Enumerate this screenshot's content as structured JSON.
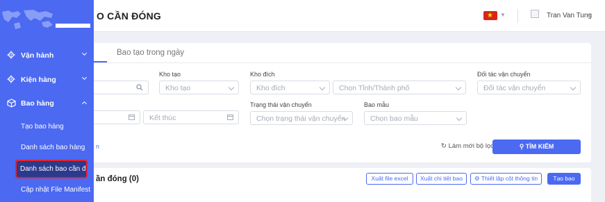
{
  "header": {
    "page_title": "O CẦN ĐÓNG",
    "user_name": "Tran Van Tung"
  },
  "filter": {
    "tab_label": "Bao tạo trong ngày",
    "kho_tao": {
      "label": "Kho tạo",
      "placeholder": "Kho tạo"
    },
    "kho_dich": {
      "label": "Kho đích",
      "placeholder": "Kho đích"
    },
    "tinh_thanh": {
      "placeholder": "Chọn Tỉnh/Thành phố"
    },
    "doi_tac": {
      "label": "Đối tác vận chuyển",
      "placeholder": "Đối tác vận chuyển"
    },
    "ket_thuc": {
      "placeholder": "Kết thúc"
    },
    "trang_thai": {
      "label": "Trạng thái vận chuyển",
      "placeholder": "Chọn trạng thái vận chuyển"
    },
    "bao_mau": {
      "label": "Bao mẫu",
      "placeholder": "Chọn bao mẫu"
    },
    "collapse_link": "n",
    "reset_label": "Làm mới bộ lọc",
    "search_label": "TÌM KIẾM"
  },
  "list": {
    "title": "ần đóng (0)",
    "export_excel": "Xuất file excel",
    "export_detail": "Xuất chi tiết bao",
    "column_setting": "Thiết lập cột thông tin",
    "create_bag": "Tạo bao"
  },
  "sidebar": {
    "items": [
      {
        "label": "Vận hành"
      },
      {
        "label": "Kiện hàng"
      },
      {
        "label": "Bao hàng"
      }
    ],
    "sub_items": [
      {
        "label": "Tạo bao hàng"
      },
      {
        "label": "Danh sách bao hàng"
      },
      {
        "label": "Danh sách bao cần đó..."
      },
      {
        "label": "Cập nhật File Manifest"
      }
    ]
  },
  "colors": {
    "primary": "#4b69f1",
    "active_outline": "#e8222b"
  }
}
